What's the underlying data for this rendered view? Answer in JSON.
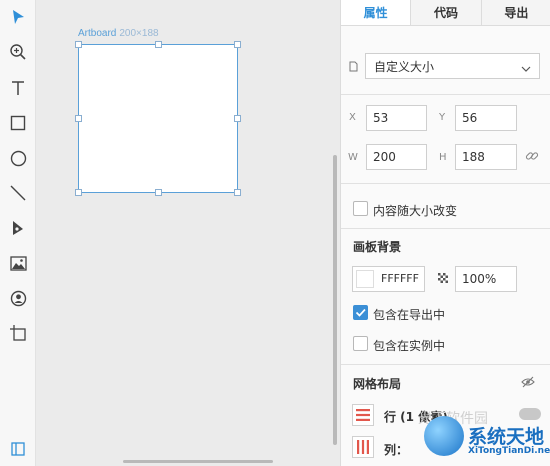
{
  "toolbar": {
    "tools": [
      "select-arrow-icon",
      "zoom-icon",
      "text-icon",
      "rectangle-icon",
      "ellipse-icon",
      "line-icon",
      "pen-icon",
      "image-icon",
      "symbol-icon",
      "artboard-icon",
      "layers-panel-icon"
    ],
    "accent_color": "#2f8fd8"
  },
  "canvas": {
    "artboard_name": "Artboard",
    "artboard_dims": "200×188"
  },
  "panel": {
    "tabs": [
      {
        "label": "属性",
        "active": true
      },
      {
        "label": "代码",
        "active": false
      },
      {
        "label": "导出",
        "active": false
      }
    ],
    "preset": {
      "value": "自定义大小"
    },
    "fields": {
      "x": {
        "label": "X",
        "value": "53"
      },
      "y": {
        "label": "Y",
        "value": "56"
      },
      "w": {
        "label": "W",
        "value": "200"
      },
      "h": {
        "label": "H",
        "value": "188"
      }
    },
    "resize_content": {
      "label": "内容随大小改变",
      "checked": false
    },
    "background": {
      "title": "画板背景",
      "color": "FFFFFF",
      "opacity": "100%",
      "include_in_export": {
        "label": "包含在导出中",
        "checked": true
      },
      "include_in_instance": {
        "label": "包含在实例中",
        "checked": false
      }
    },
    "grid": {
      "title": "网格布局",
      "rows_label": "行 (1 像素)",
      "cols_label": "列："
    }
  },
  "watermark": {
    "faint_text": "光下软件园",
    "title": "系统天地",
    "url": "XiTongTianDi.net"
  }
}
